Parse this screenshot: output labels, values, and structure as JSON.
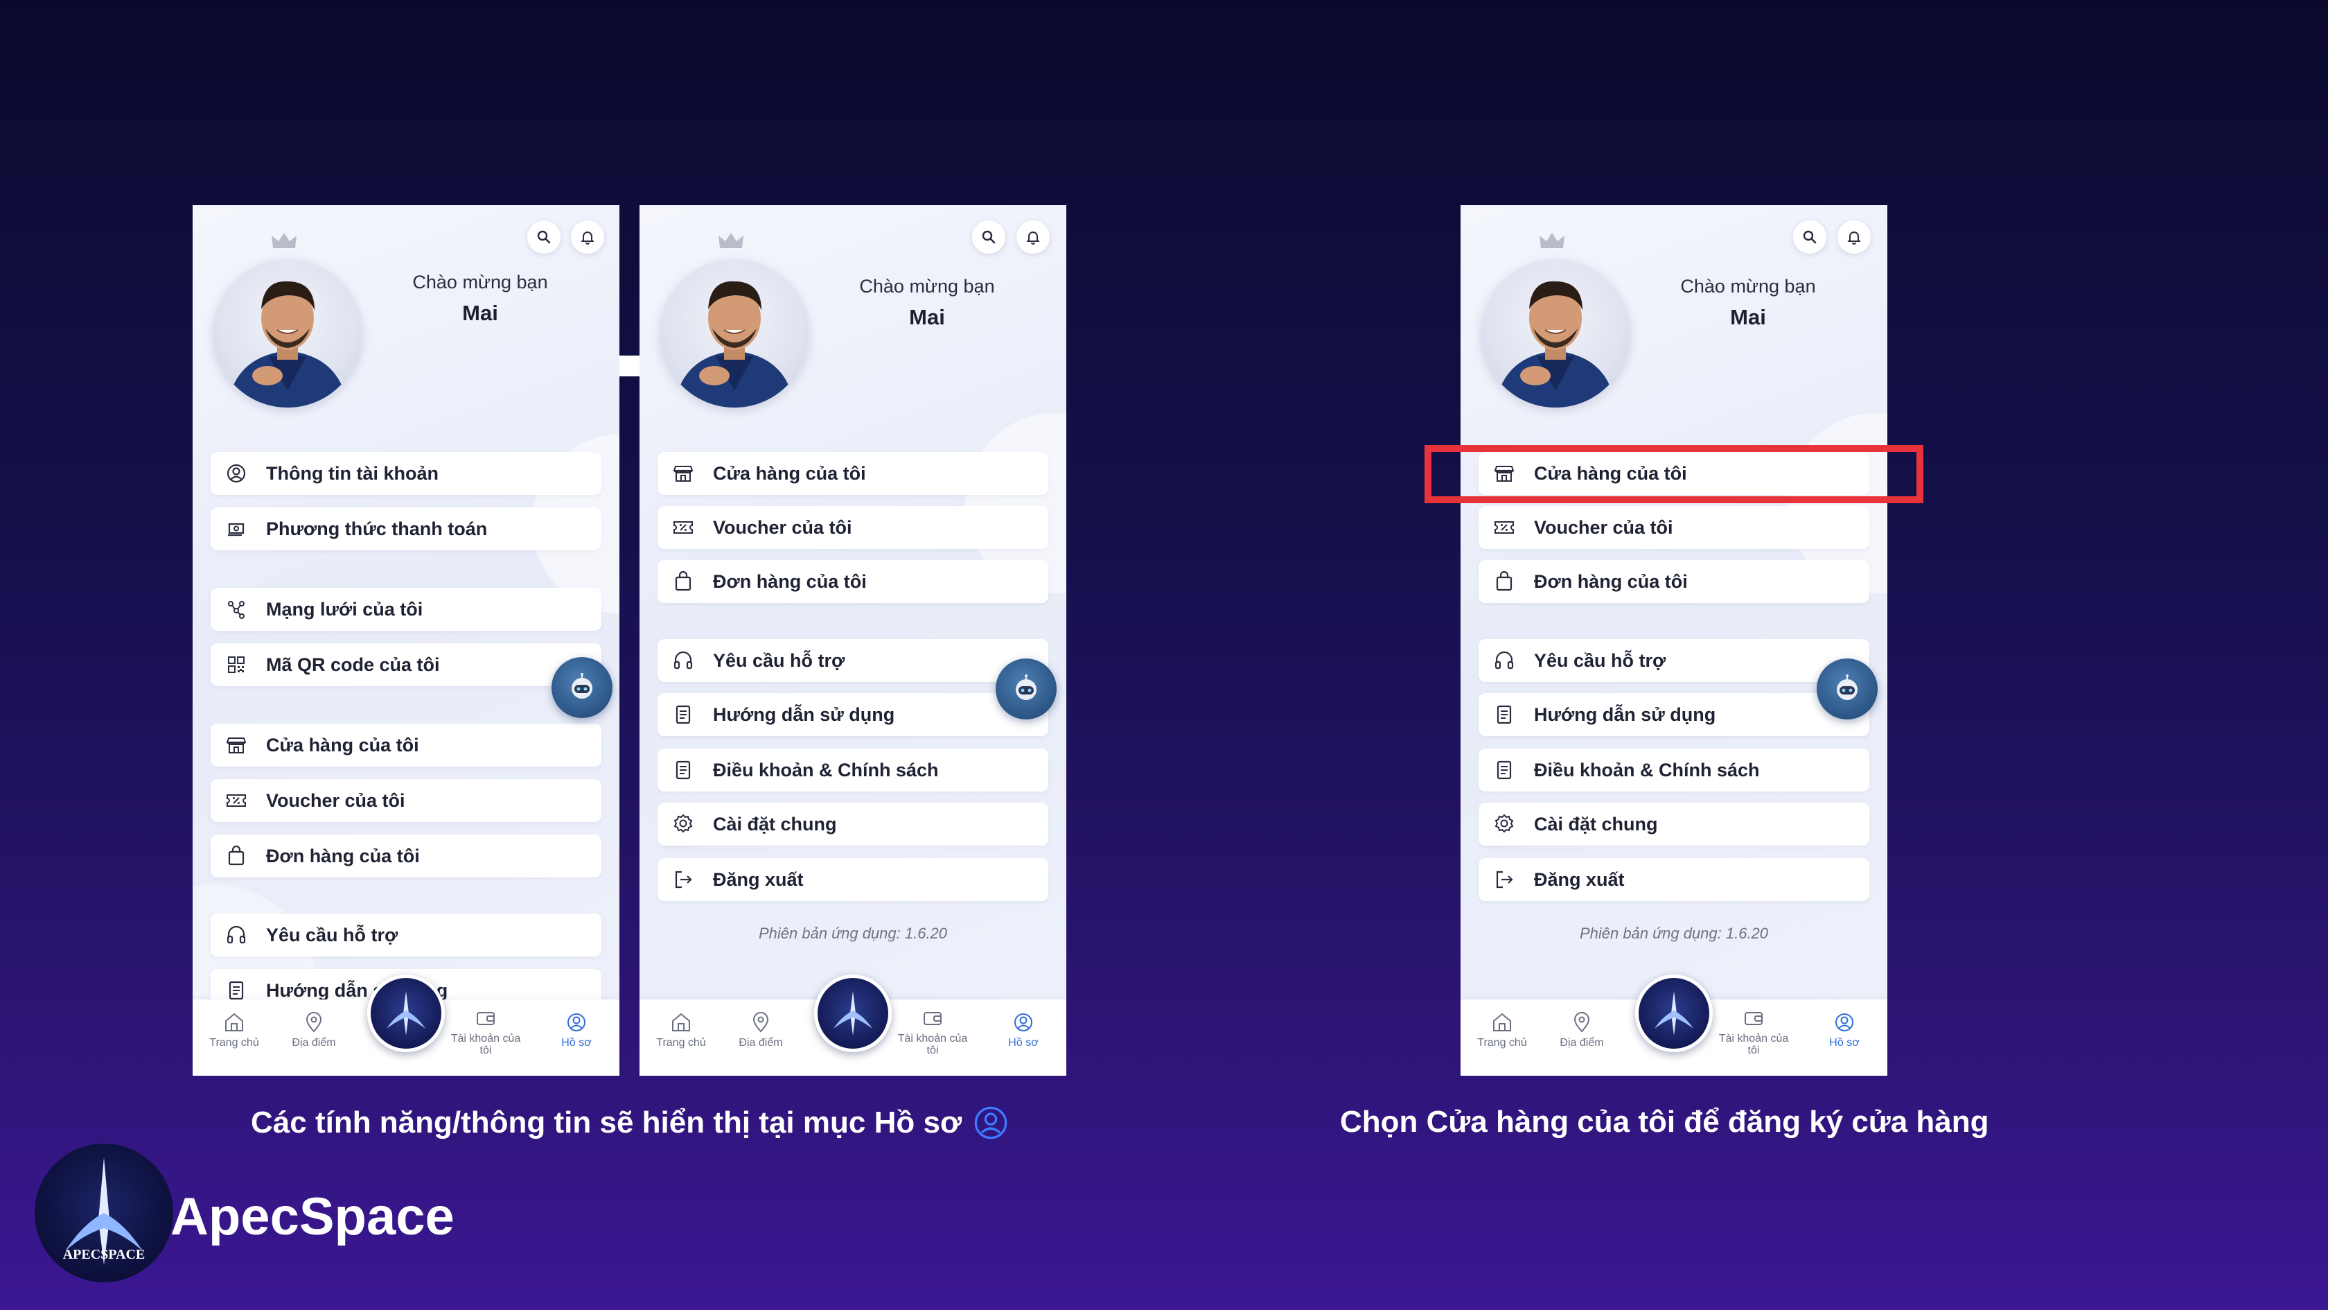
{
  "brand": {
    "name": "ApecSpace",
    "logo_text": "APECSPACE"
  },
  "captions": {
    "left": "Các tính năng/thông tin sẽ hiển thị tại mục Hồ sơ",
    "right": "Chọn Cửa hàng của tôi để đăng ký cửa hàng"
  },
  "profile": {
    "greeting": "Chào mừng bạn",
    "name": "Mai"
  },
  "phone1": {
    "menu": [
      {
        "label": "Thông tin tài khoản",
        "icon": "user-circle-icon"
      },
      {
        "label": "Phương thức thanh toán",
        "icon": "payment-icon"
      },
      {
        "label": "Mạng lưới của tôi",
        "icon": "network-icon"
      },
      {
        "label": "Mã QR code của tôi",
        "icon": "qr-code-icon"
      },
      {
        "label": "Cửa hàng của tôi",
        "icon": "store-icon"
      },
      {
        "label": "Voucher của tôi",
        "icon": "voucher-icon"
      },
      {
        "label": "Đơn hàng của tôi",
        "icon": "shopping-bag-icon"
      },
      {
        "label": "Yêu cầu hỗ trợ",
        "icon": "headset-icon"
      },
      {
        "label": "Hướng dẫn sử dụng",
        "icon": "document-icon"
      }
    ]
  },
  "phone2": {
    "menu": [
      {
        "label": "Cửa hàng của tôi",
        "icon": "store-icon"
      },
      {
        "label": "Voucher của tôi",
        "icon": "voucher-icon"
      },
      {
        "label": "Đơn hàng của tôi",
        "icon": "shopping-bag-icon"
      },
      {
        "label": "Yêu cầu hỗ trợ",
        "icon": "headset-icon"
      },
      {
        "label": "Hướng dẫn sử dụng",
        "icon": "document-icon"
      },
      {
        "label": "Điều khoản & Chính sách",
        "icon": "document-icon"
      },
      {
        "label": "Cài đặt chung",
        "icon": "settings-icon"
      },
      {
        "label": "Đăng xuất",
        "icon": "logout-icon"
      }
    ],
    "version": "Phiên bản ứng dụng: 1.6.20"
  },
  "bottom_nav": {
    "home": "Trang chủ",
    "places": "Địa điểm",
    "account": "Tài khoản của tôi",
    "profile": "Hồ sơ"
  },
  "colors": {
    "highlight": "#e8333a",
    "active_nav": "#2f6ed8",
    "background_top": "#0b0a2e",
    "background_bottom": "#3b1793"
  }
}
